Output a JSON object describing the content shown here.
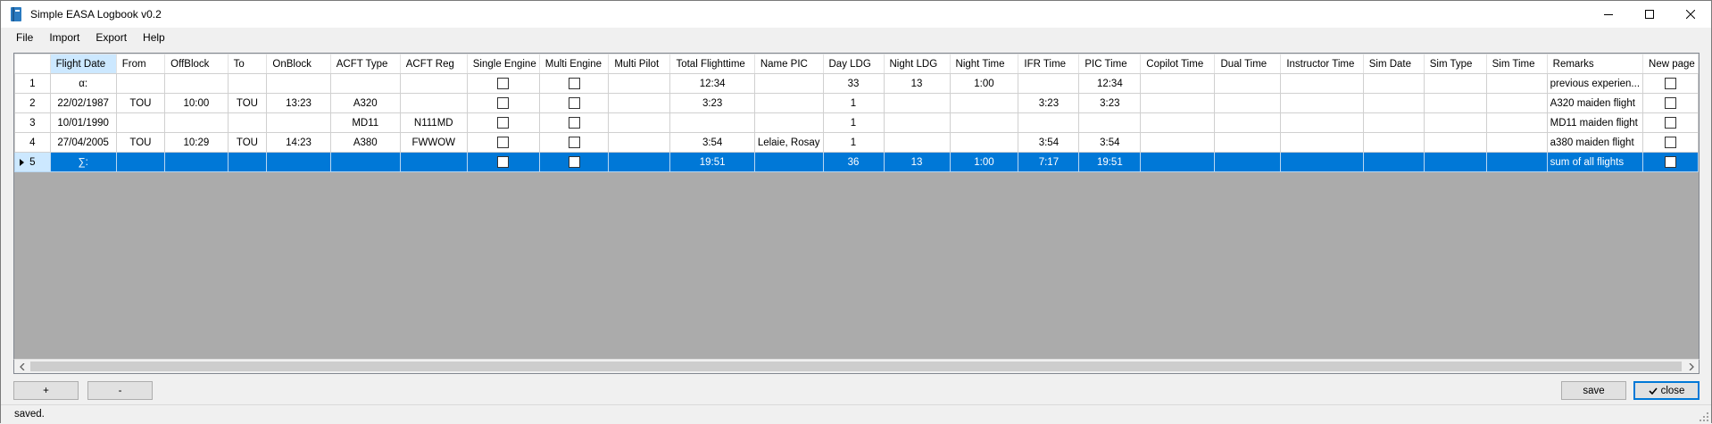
{
  "window": {
    "title": "Simple EASA Logbook v0.2"
  },
  "menu": [
    "File",
    "Import",
    "Export",
    "Help"
  ],
  "columns": [
    "Flight Date",
    "From",
    "OffBlock",
    "To",
    "OnBlock",
    "ACFT Type",
    "ACFT Reg",
    "Single Engine",
    "Multi Engine",
    "Multi Pilot",
    "Total Flighttime",
    "Name PIC",
    "Day LDG",
    "Night LDG",
    "Night Time",
    "IFR Time",
    "PIC Time",
    "Copilot Time",
    "Dual Time",
    "Instructor Time",
    "Sim Date",
    "Sim Type",
    "Sim Time",
    "Remarks",
    "New page"
  ],
  "rows": [
    {
      "num": "1",
      "cells": [
        "α:",
        "",
        "",
        "",
        "",
        "",
        "",
        "",
        "",
        "",
        "12:34",
        "",
        "33",
        "13",
        "1:00",
        "",
        "12:34",
        "",
        "",
        "",
        "",
        "",
        "",
        "previous experien..."
      ],
      "single_engine": false,
      "multi_engine": false,
      "new_page": false
    },
    {
      "num": "2",
      "cells": [
        "22/02/1987",
        "TOU",
        "10:00",
        "TOU",
        "13:23",
        "A320",
        "",
        "",
        "",
        "",
        "3:23",
        "",
        "1",
        "",
        "",
        "3:23",
        "3:23",
        "",
        "",
        "",
        "",
        "",
        "",
        "A320 maiden flight"
      ],
      "single_engine": false,
      "multi_engine": false,
      "new_page": false
    },
    {
      "num": "3",
      "cells": [
        "10/01/1990",
        "",
        "",
        "",
        "",
        "MD11",
        "N111MD",
        "",
        "",
        "",
        "",
        "",
        "1",
        "",
        "",
        "",
        "",
        "",
        "",
        "",
        "",
        "",
        "",
        "MD11 maiden flight"
      ],
      "single_engine": false,
      "multi_engine": false,
      "new_page": false
    },
    {
      "num": "4",
      "cells": [
        "27/04/2005",
        "TOU",
        "10:29",
        "TOU",
        "14:23",
        "A380",
        "FWWOW",
        "",
        "",
        "",
        "3:54",
        "Lelaie, Rosay",
        "1",
        "",
        "",
        "3:54",
        "3:54",
        "",
        "",
        "",
        "",
        "",
        "",
        "a380 maiden flight"
      ],
      "single_engine": false,
      "multi_engine": false,
      "new_page": false
    },
    {
      "num": "5",
      "cells": [
        "∑:",
        "",
        "",
        "",
        "",
        "",
        "",
        "",
        "",
        "",
        "19:51",
        "",
        "36",
        "13",
        "1:00",
        "7:17",
        "19:51",
        "",
        "",
        "",
        "",
        "",
        "",
        "sum of all flights"
      ],
      "single_engine": false,
      "multi_engine": false,
      "new_page": false,
      "selected": true
    }
  ],
  "buttons": {
    "add": "+",
    "remove": "-",
    "save": "save",
    "close": "close"
  },
  "status": "saved.",
  "colors": {
    "selection": "#0078d7",
    "sorted_header": "#cce8ff",
    "grid_background": "#ababab"
  },
  "icons": {
    "app": "logbook-icon",
    "close_button": "checkmark-icon"
  }
}
